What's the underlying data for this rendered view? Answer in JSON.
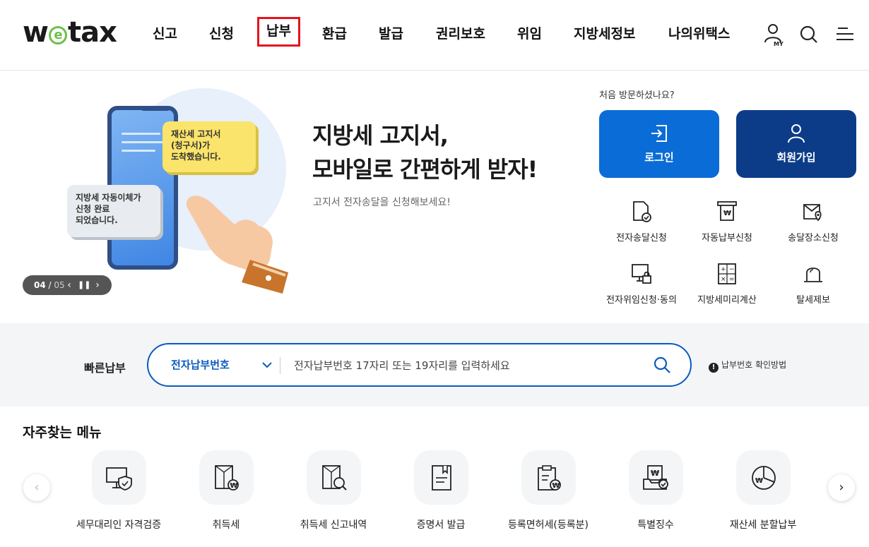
{
  "header": {
    "logo": "wetax",
    "nav": [
      "신고",
      "신청",
      "납부",
      "환급",
      "발급",
      "권리보호",
      "위임",
      "지방세정보",
      "나의위택스"
    ],
    "active_nav": "납부",
    "icons": [
      "my-page-icon",
      "search-icon",
      "menu-icon"
    ],
    "my_label": "MY"
  },
  "hero": {
    "yellow_bubble": "재산세 고지서\n(청구서)가\n도착했습니다.",
    "gray_bubble": "지방세 자동이체가\n신청 완료\n되었습니다.",
    "title_line1": "지방세 고지서,",
    "title_line2": "모바일로 간편하게 받자!",
    "subtitle": "고지서 전자송달을 신청해보세요!",
    "slide_current": "04",
    "slide_total": "05"
  },
  "account": {
    "first_visit": "처음 방문하셨나요?",
    "login_label": "로그인",
    "join_label": "회원가입"
  },
  "quick_links": [
    {
      "label": "전자송달신청",
      "icon": "document-check-icon"
    },
    {
      "label": "자동납부신청",
      "icon": "auto-pay-icon"
    },
    {
      "label": "송달장소신청",
      "icon": "mail-location-icon"
    },
    {
      "label": "전자위임신청·동의",
      "icon": "monitor-lock-icon"
    },
    {
      "label": "지방세미리계산",
      "icon": "calculator-icon"
    },
    {
      "label": "탈세제보",
      "icon": "alarm-bell-icon"
    }
  ],
  "quick_pay": {
    "label": "빠른납부",
    "select_value": "전자납부번호",
    "placeholder": "전자납부번호 17자리 또는 19자리를 입력하세요",
    "help_text": "납부번호 확인방법"
  },
  "frequent_menu": {
    "title": "자주찾는 메뉴",
    "items": [
      {
        "label": "세무대리인 자격검증",
        "icon": "monitor-shield-icon"
      },
      {
        "label": "취득세",
        "icon": "document-won-icon"
      },
      {
        "label": "취득세 신고내역",
        "icon": "document-search-icon"
      },
      {
        "label": "증명서 발급",
        "icon": "certificate-icon"
      },
      {
        "label": "등록면허세(등록분)",
        "icon": "clipboard-won-icon"
      },
      {
        "label": "특별징수",
        "icon": "tray-won-check-icon"
      },
      {
        "label": "재산세 분할납부",
        "icon": "pie-chart-won-icon"
      }
    ]
  },
  "colors": {
    "accent_blue": "#0a6cd6",
    "dark_blue": "#0c3c88",
    "highlight_red": "#e4141e",
    "logo_green": "#6cc04a"
  }
}
